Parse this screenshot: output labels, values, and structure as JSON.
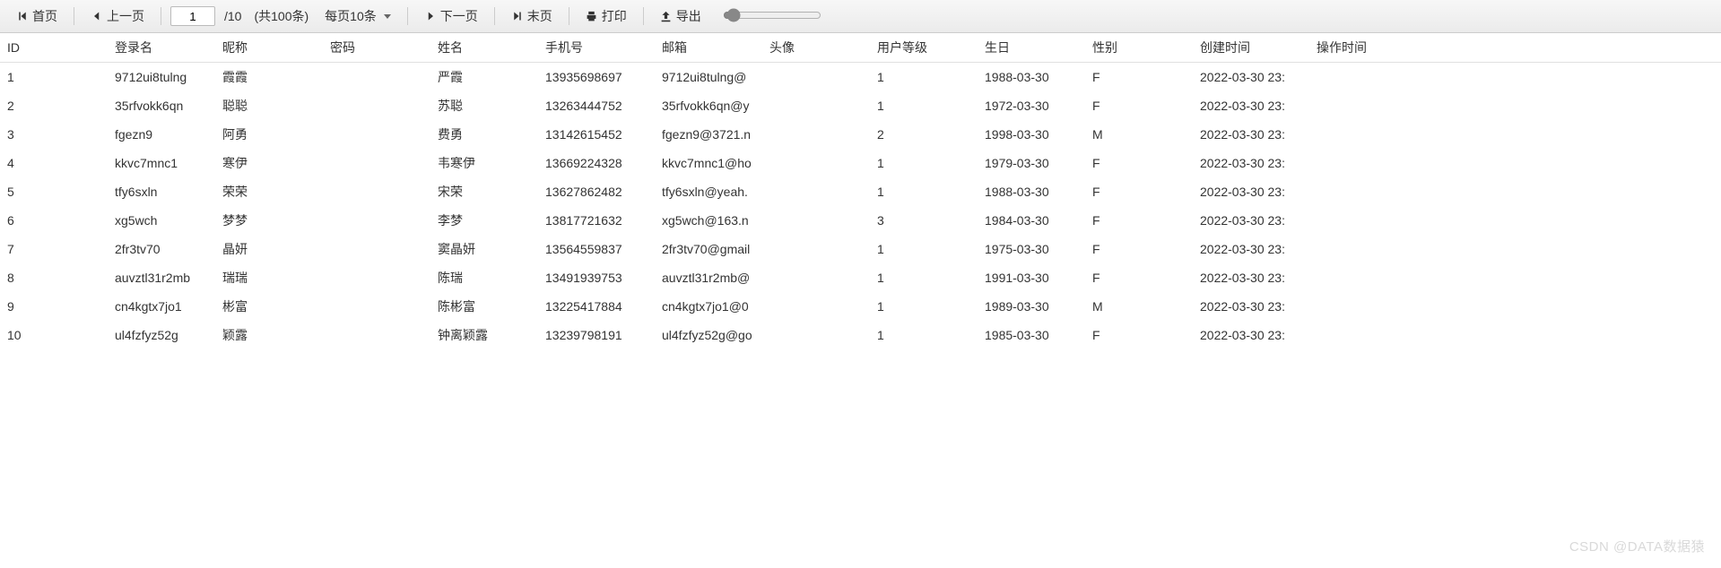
{
  "toolbar": {
    "first_label": "首页",
    "prev_label": "上一页",
    "page_value": "1",
    "page_total": "/10",
    "page_count": "(共100条)",
    "per_page_label": "每页10条",
    "next_label": "下一页",
    "last_label": "末页",
    "print_label": "打印",
    "export_label": "导出"
  },
  "columns": [
    "ID",
    "登录名",
    "昵称",
    "密码",
    "姓名",
    "手机号",
    "邮箱",
    "头像",
    "用户等级",
    "生日",
    "性别",
    "创建时间",
    "操作时间"
  ],
  "rows": [
    {
      "id": "1",
      "login": "9712ui8tulng",
      "nick": "霞霞",
      "pwd": "",
      "name": "严霞",
      "phone": "13935698697",
      "email": "9712ui8tulng@",
      "avatar": "",
      "level": "1",
      "birthday": "1988-03-30",
      "gender": "F",
      "created": "2022-03-30 23:",
      "op": ""
    },
    {
      "id": "2",
      "login": "35rfvokk6qn",
      "nick": "聪聪",
      "pwd": "",
      "name": "苏聪",
      "phone": "13263444752",
      "email": "35rfvokk6qn@y",
      "avatar": "",
      "level": "1",
      "birthday": "1972-03-30",
      "gender": "F",
      "created": "2022-03-30 23:",
      "op": ""
    },
    {
      "id": "3",
      "login": "fgezn9",
      "nick": "阿勇",
      "pwd": "",
      "name": "费勇",
      "phone": "13142615452",
      "email": "fgezn9@3721.n",
      "avatar": "",
      "level": "2",
      "birthday": "1998-03-30",
      "gender": "M",
      "created": "2022-03-30 23:",
      "op": ""
    },
    {
      "id": "4",
      "login": "kkvc7mnc1",
      "nick": "寒伊",
      "pwd": "",
      "name": "韦寒伊",
      "phone": "13669224328",
      "email": "kkvc7mnc1@ho",
      "avatar": "",
      "level": "1",
      "birthday": "1979-03-30",
      "gender": "F",
      "created": "2022-03-30 23:",
      "op": ""
    },
    {
      "id": "5",
      "login": "tfy6sxln",
      "nick": "荣荣",
      "pwd": "",
      "name": "宋荣",
      "phone": "13627862482",
      "email": "tfy6sxln@yeah.",
      "avatar": "",
      "level": "1",
      "birthday": "1988-03-30",
      "gender": "F",
      "created": "2022-03-30 23:",
      "op": ""
    },
    {
      "id": "6",
      "login": "xg5wch",
      "nick": "梦梦",
      "pwd": "",
      "name": "李梦",
      "phone": "13817721632",
      "email": "xg5wch@163.n",
      "avatar": "",
      "level": "3",
      "birthday": "1984-03-30",
      "gender": "F",
      "created": "2022-03-30 23:",
      "op": ""
    },
    {
      "id": "7",
      "login": "2fr3tv70",
      "nick": "晶妍",
      "pwd": "",
      "name": "窦晶妍",
      "phone": "13564559837",
      "email": "2fr3tv70@gmail",
      "avatar": "",
      "level": "1",
      "birthday": "1975-03-30",
      "gender": "F",
      "created": "2022-03-30 23:",
      "op": ""
    },
    {
      "id": "8",
      "login": "auvztl31r2mb",
      "nick": "瑞瑞",
      "pwd": "",
      "name": "陈瑞",
      "phone": "13491939753",
      "email": "auvztl31r2mb@",
      "avatar": "",
      "level": "1",
      "birthday": "1991-03-30",
      "gender": "F",
      "created": "2022-03-30 23:",
      "op": ""
    },
    {
      "id": "9",
      "login": "cn4kgtx7jo1",
      "nick": "彬富",
      "pwd": "",
      "name": "陈彬富",
      "phone": "13225417884",
      "email": "cn4kgtx7jo1@0",
      "avatar": "",
      "level": "1",
      "birthday": "1989-03-30",
      "gender": "M",
      "created": "2022-03-30 23:",
      "op": ""
    },
    {
      "id": "10",
      "login": "ul4fzfyz52g",
      "nick": "颖露",
      "pwd": "",
      "name": "钟离颖露",
      "phone": "13239798191",
      "email": "ul4fzfyz52g@go",
      "avatar": "",
      "level": "1",
      "birthday": "1985-03-30",
      "gender": "F",
      "created": "2022-03-30 23:",
      "op": ""
    }
  ],
  "watermark": "CSDN @DATA数据猿"
}
